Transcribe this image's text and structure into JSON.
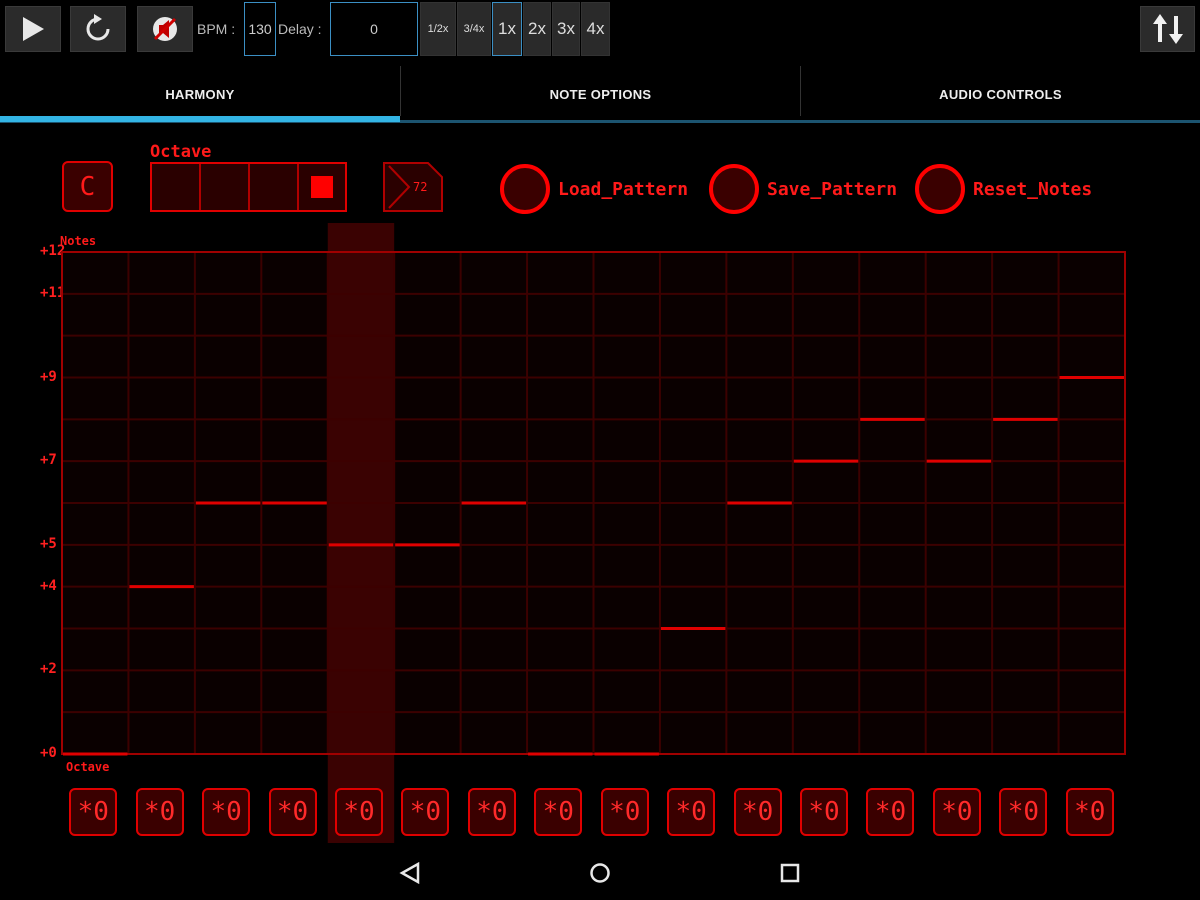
{
  "toolbar": {
    "play_icon": "play-icon",
    "loop_icon": "loop-icon",
    "mute_icon": "mute-icon",
    "bpm_label": "BPM :",
    "bpm_value": "130",
    "delay_label": "Delay :",
    "delay_value": "0",
    "speeds": [
      "1/2x",
      "3/4x",
      "1x",
      "2x",
      "3x",
      "4x"
    ],
    "selected_speed": "1x",
    "swap_icon": "swap-vertical-icon"
  },
  "tabs": [
    {
      "label": "HARMONY",
      "active": true
    },
    {
      "label": "NOTE OPTIONS",
      "active": false
    },
    {
      "label": "AUDIO CONTROLS",
      "active": false
    }
  ],
  "controls": {
    "key": "C",
    "octave_label": "Octave",
    "octave_cells": 4,
    "octave_selected": 4,
    "midi_value": "72",
    "actions": [
      "Load_Pattern",
      "Save_Pattern",
      "Reset_Notes"
    ]
  },
  "grid": {
    "notes_label": "Notes",
    "octave_label": "Octave",
    "y_ticks": [
      "+12",
      "+11",
      "+9",
      "+7",
      "+5",
      "+4",
      "+2",
      "+0"
    ],
    "y_tick_values": [
      12,
      11,
      9,
      7,
      5,
      4,
      2,
      0
    ],
    "steps": 16,
    "rows": 12,
    "highlighted_step": 5,
    "notes": [
      0,
      4,
      6,
      6,
      5,
      5,
      6,
      0,
      0,
      3,
      6,
      7,
      8,
      7,
      8,
      9
    ]
  },
  "octave_buttons": [
    "*0",
    "*0",
    "*0",
    "*0",
    "*0",
    "*0",
    "*0",
    "*0",
    "*0",
    "*0",
    "*0",
    "*0",
    "*0",
    "*0",
    "*0",
    "*0"
  ],
  "colors": {
    "accent_red": "#ff0000",
    "tab_indicator": "#33b5e5",
    "background": "#000000"
  },
  "navbar": {
    "back_icon": "back-triangle-icon",
    "home_icon": "home-circle-icon",
    "recents_icon": "recents-square-icon"
  }
}
